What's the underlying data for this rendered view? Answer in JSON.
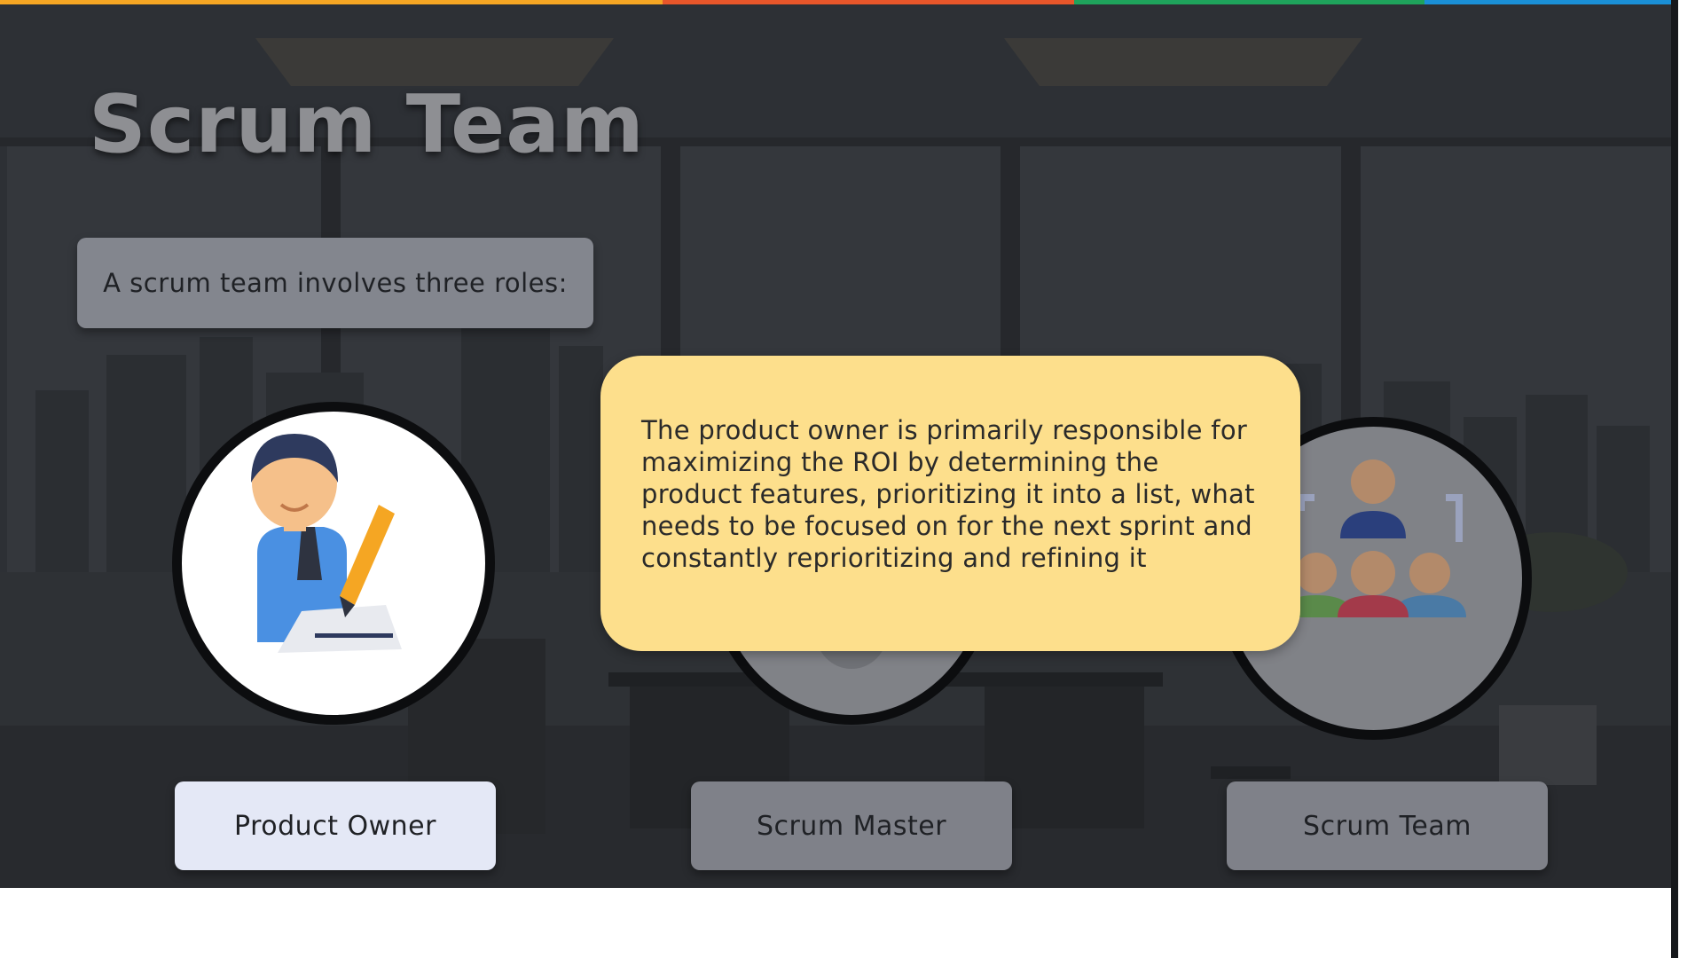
{
  "slide": {
    "title": "Scrum Team",
    "intro": "A scrum team involves three roles:",
    "tooltip": "The product owner is primarily responsible for maximizing the ROI by determining the product features, prioritizing it into a list, what needs to be focused on for the next sprint and constantly reprioritizing and refining it",
    "roles": [
      {
        "label": "Product Owner",
        "icon": "product-owner-icon",
        "active": true
      },
      {
        "label": "Scrum Master",
        "icon": "scrum-master-icon",
        "active": false
      },
      {
        "label": "Scrum Team",
        "icon": "scrum-team-icon",
        "active": false
      }
    ]
  },
  "colors": {
    "accent_orange": "#f5a623",
    "accent_red": "#e8562a",
    "accent_green": "#1fa35c",
    "accent_blue": "#1a8fd6",
    "tooltip_bg": "#fddf8c",
    "active_role_bg": "#e4e8f6",
    "inactive_role_bg": "#7f8189",
    "background": "#2d3035"
  }
}
